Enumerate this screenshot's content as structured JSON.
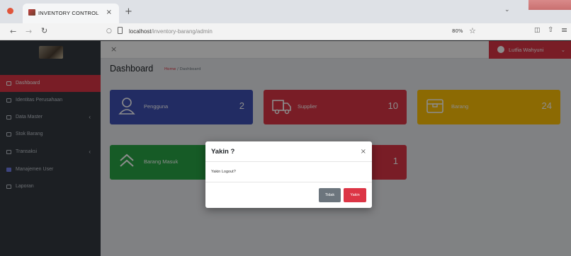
{
  "browser": {
    "tab_title": "INVENTORY CONTROL",
    "tab_close": "×",
    "new_tab": "+",
    "url_host": "localhost",
    "url_path": "/inventory-barang/admin",
    "zoom": "80%"
  },
  "sidebar": {
    "items": [
      {
        "label": "Dashboard",
        "active": true
      },
      {
        "label": "Identitas Perusahaan"
      },
      {
        "label": "Data Master",
        "chevron": "‹"
      },
      {
        "label": "Stok Barang"
      },
      {
        "label": "Transaksi",
        "chevron": "‹"
      },
      {
        "label": "Manajemen User"
      },
      {
        "label": "Laporan"
      }
    ]
  },
  "topnav": {
    "menu_icon": "×",
    "user_name": "Lutfia Wahyuni",
    "user_chevron": "⌄"
  },
  "page": {
    "title": "Dashboard",
    "breadcrumb_home": "Home",
    "breadcrumb_sep": "/",
    "breadcrumb_current": "Dashboard"
  },
  "cards": [
    {
      "label": "Pengguna",
      "value": "2",
      "color": "#3f51b5",
      "icon": "user-icon"
    },
    {
      "label": "Supplier",
      "value": "10",
      "color": "#dc3545",
      "icon": "truck-icon"
    },
    {
      "label": "Barang",
      "value": "24",
      "color": "#ffc107",
      "icon": "box-icon"
    },
    {
      "label": "Barang Masuk",
      "value": "",
      "color": "#28a745",
      "icon": "chevrons-up-icon"
    },
    {
      "label": "",
      "value": "1",
      "color": "#dc3545",
      "icon": ""
    }
  ],
  "modal": {
    "title": "Yakin ?",
    "close": "×",
    "body": "Yakin Logout?",
    "cancel_label": "Tidak",
    "confirm_label": "Yakin"
  },
  "colors": {
    "accent": "#dc3545",
    "sidebar_bg": "#343a40",
    "overlay": "rgba(0,0,0,0.45)"
  }
}
